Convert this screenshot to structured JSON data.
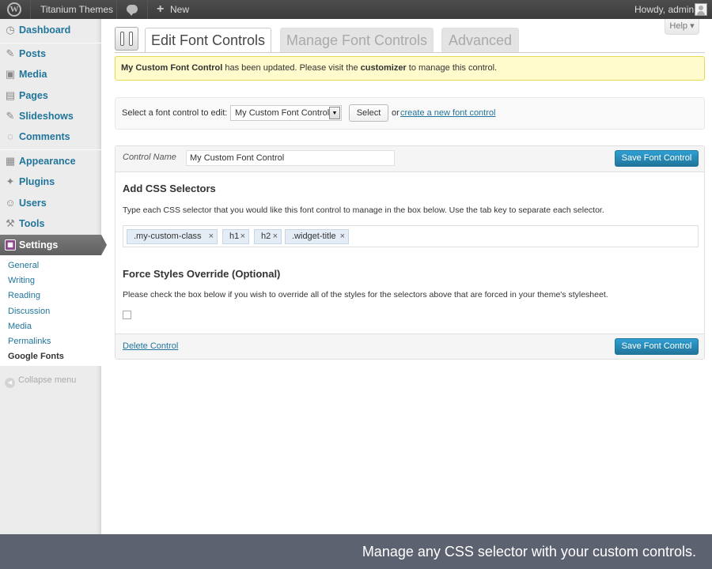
{
  "adminbar": {
    "site_name": "Titanium Themes",
    "new_label": "New",
    "plus_glyph": "+",
    "greeting": "Howdy, admin",
    "logo_glyph": "W"
  },
  "sidebar": {
    "items": [
      {
        "label": "Dashboard",
        "icon": "dashboard-icon",
        "glyph": "◷"
      },
      {
        "label": "Posts",
        "icon": "pin-icon",
        "glyph": "✎"
      },
      {
        "label": "Media",
        "icon": "media-icon",
        "glyph": "▣"
      },
      {
        "label": "Pages",
        "icon": "pages-icon",
        "glyph": "▤"
      },
      {
        "label": "Slideshows",
        "icon": "slideshow-icon",
        "glyph": "✎"
      },
      {
        "label": "Comments",
        "icon": "comment-icon",
        "glyph": "◌"
      },
      {
        "label": "Appearance",
        "icon": "appearance-icon",
        "glyph": "▦"
      },
      {
        "label": "Plugins",
        "icon": "plugin-icon",
        "glyph": "✦"
      },
      {
        "label": "Users",
        "icon": "users-icon",
        "glyph": "☺"
      },
      {
        "label": "Tools",
        "icon": "tools-icon",
        "glyph": "⚒"
      }
    ],
    "current": {
      "label": "Settings",
      "icon": "settings-icon",
      "glyph": "▦"
    },
    "submenu": [
      "General",
      "Writing",
      "Reading",
      "Discussion",
      "Media",
      "Permalinks",
      "Google Fonts"
    ],
    "collapse_label": "Collapse menu",
    "collapse_glyph": "◀"
  },
  "help_label": "Help ▾",
  "tabs": [
    "Edit Font Controls",
    "Manage Font Controls",
    "Advanced"
  ],
  "notice": {
    "control_name": "My Custom Font Control",
    "text_1": "has been updated. Please visit the",
    "link_word": "customizer",
    "text_2": "to manage this control."
  },
  "select_bar": {
    "label": "Select a font control to edit:",
    "selected": "My Custom Font Control",
    "arrow": "▼",
    "button": "Select",
    "or": "or",
    "create_link": "create a new font control"
  },
  "editor": {
    "control_name_label": "Control Name",
    "control_name_value": "My Custom Font Control",
    "save_label": "Save Font Control",
    "css_title": "Add CSS Selectors",
    "css_desc": "Type each CSS selector that you would like this font control to manage in the box below. Use the tab key to separate each selector.",
    "selectors": [
      ".my-custom-class",
      "h1",
      "h2",
      ".widget-title"
    ],
    "remove_glyph": "×",
    "force_title": "Force Styles Override (Optional)",
    "force_desc": "Please check the box below if you wish to override all of the styles for the selectors above that are forced in your theme's stylesheet.",
    "force_checked": false,
    "delete_label": "Delete Control"
  },
  "banner": "Manage any CSS selector with your custom controls."
}
